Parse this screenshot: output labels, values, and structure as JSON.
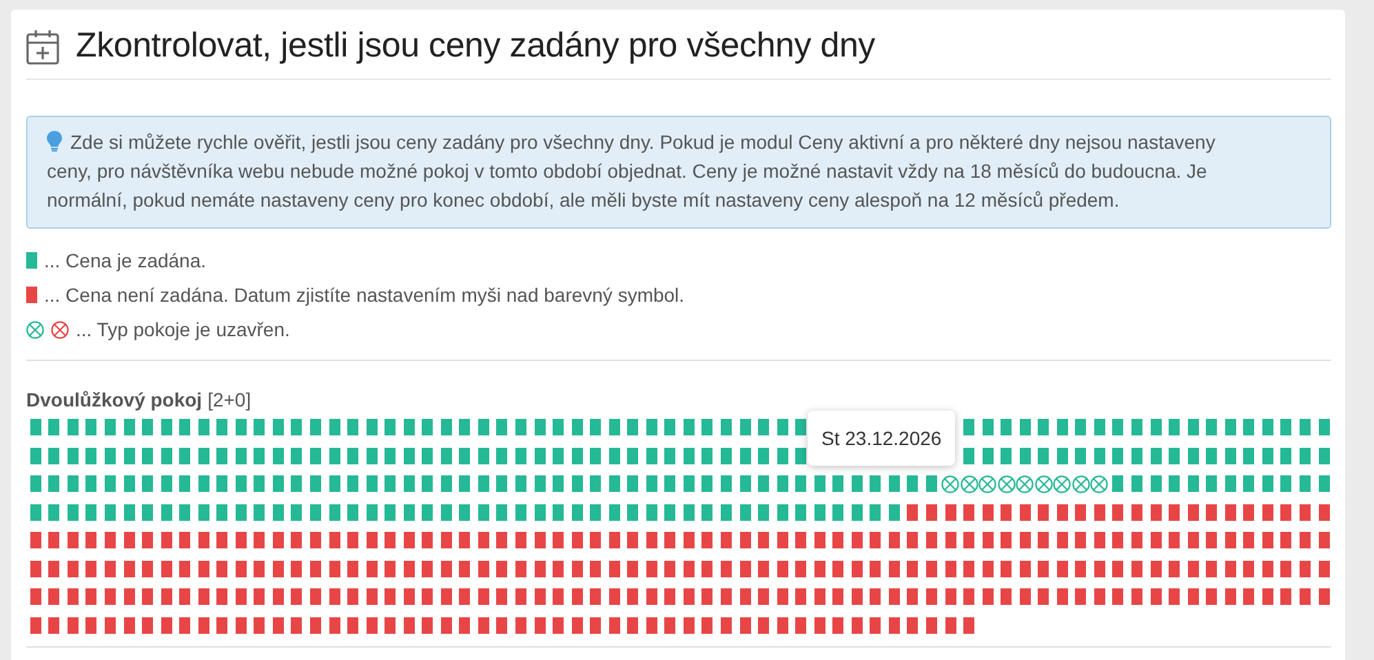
{
  "title": "Zkontrolovat, jestli jsou ceny zadány pro všechny dny",
  "info": "Zde si můžete rychle ověřit, jestli jsou ceny zadány pro všechny dny. Pokud je modul Ceny aktivní a pro některé dny nejsou nastaveny ceny, pro návštěvníka webu nebude možné pokoj v tomto období objednat. Ceny je možné nastavit vždy na 18 měsíců do budoucna. Je normální, pokud nemáte nastaveny ceny pro konec období, ale měli byste mít nastaveny ceny alespoň na 12 měsíců předem.",
  "legend": [
    {
      "kind": "set",
      "text": "... Cena je zadána."
    },
    {
      "kind": "unset",
      "text": "... Cena není zadána. Datum zjistíte nastavením myši nad barevný symbol."
    },
    {
      "kind": "closed",
      "text": "... Typ pokoje je uzavřen."
    }
  ],
  "rooms": [
    {
      "name": "Dvoulůžkový pokoj",
      "capacity": "[2+0]",
      "tooltip": "St 23.12.2026",
      "rows": [
        [
          {
            "kind": "set"
          },
          {
            "kind": "set"
          },
          {
            "kind": "set"
          },
          {
            "kind": "set"
          },
          {
            "kind": "set"
          },
          {
            "kind": "set"
          },
          {
            "kind": "set"
          },
          {
            "kind": "set"
          },
          {
            "kind": "set"
          },
          {
            "kind": "set"
          },
          {
            "kind": "set"
          },
          {
            "kind": "set"
          },
          {
            "kind": "set"
          },
          {
            "kind": "set"
          },
          {
            "kind": "set"
          },
          {
            "kind": "set"
          },
          {
            "kind": "set"
          },
          {
            "kind": "set"
          },
          {
            "kind": "set"
          },
          {
            "kind": "set"
          },
          {
            "kind": "set"
          },
          {
            "kind": "set"
          },
          {
            "kind": "set"
          },
          {
            "kind": "set"
          },
          {
            "kind": "set"
          },
          {
            "kind": "set"
          },
          {
            "kind": "set"
          },
          {
            "kind": "set"
          },
          {
            "kind": "set"
          },
          {
            "kind": "set"
          },
          {
            "kind": "set"
          },
          {
            "kind": "set"
          },
          {
            "kind": "set"
          },
          {
            "kind": "set"
          },
          {
            "kind": "set"
          },
          {
            "kind": "set"
          },
          {
            "kind": "set"
          },
          {
            "kind": "set"
          },
          {
            "kind": "set"
          },
          {
            "kind": "set"
          },
          {
            "kind": "set"
          },
          {
            "kind": "set"
          },
          null,
          null,
          null,
          null,
          null,
          null,
          null,
          null,
          {
            "kind": "set"
          },
          {
            "kind": "set"
          },
          {
            "kind": "set"
          },
          {
            "kind": "set"
          },
          {
            "kind": "set"
          },
          {
            "kind": "set"
          },
          {
            "kind": "set"
          },
          {
            "kind": "set"
          },
          {
            "kind": "set"
          },
          {
            "kind": "set"
          },
          {
            "kind": "set"
          },
          {
            "kind": "set"
          },
          {
            "kind": "set"
          },
          {
            "kind": "set"
          },
          {
            "kind": "set"
          },
          {
            "kind": "set"
          },
          {
            "kind": "set"
          },
          {
            "kind": "set"
          },
          {
            "kind": "set"
          },
          {
            "kind": "set"
          }
        ],
        [
          {
            "kind": "set"
          },
          {
            "kind": "set"
          },
          {
            "kind": "set"
          },
          {
            "kind": "set"
          },
          {
            "kind": "set"
          },
          {
            "kind": "set"
          },
          {
            "kind": "set"
          },
          {
            "kind": "set"
          },
          {
            "kind": "set"
          },
          {
            "kind": "set"
          },
          {
            "kind": "set"
          },
          {
            "kind": "set"
          },
          {
            "kind": "set"
          },
          {
            "kind": "set"
          },
          {
            "kind": "set"
          },
          {
            "kind": "set"
          },
          {
            "kind": "set"
          },
          {
            "kind": "set"
          },
          {
            "kind": "set"
          },
          {
            "kind": "set"
          },
          {
            "kind": "set"
          },
          {
            "kind": "set"
          },
          {
            "kind": "set"
          },
          {
            "kind": "set"
          },
          {
            "kind": "set"
          },
          {
            "kind": "set"
          },
          {
            "kind": "set"
          },
          {
            "kind": "set"
          },
          {
            "kind": "set"
          },
          {
            "kind": "set"
          },
          {
            "kind": "set"
          },
          {
            "kind": "set"
          },
          {
            "kind": "set"
          },
          {
            "kind": "set"
          },
          {
            "kind": "set"
          },
          {
            "kind": "set"
          },
          {
            "kind": "set"
          },
          {
            "kind": "set"
          },
          {
            "kind": "set"
          },
          {
            "kind": "set"
          },
          {
            "kind": "set"
          },
          {
            "kind": "set"
          },
          null,
          null,
          null,
          null,
          null,
          null,
          null,
          null,
          {
            "kind": "set"
          },
          {
            "kind": "set"
          },
          {
            "kind": "set"
          },
          {
            "kind": "set"
          },
          {
            "kind": "set"
          },
          {
            "kind": "set"
          },
          {
            "kind": "set"
          },
          {
            "kind": "set"
          },
          {
            "kind": "set"
          },
          {
            "kind": "set"
          },
          {
            "kind": "set"
          },
          {
            "kind": "set"
          },
          {
            "kind": "set"
          },
          {
            "kind": "set"
          },
          {
            "kind": "set"
          },
          {
            "kind": "set"
          },
          {
            "kind": "set"
          },
          {
            "kind": "set"
          },
          {
            "kind": "set"
          },
          {
            "kind": "set"
          }
        ],
        [
          {
            "kind": "set"
          },
          {
            "kind": "set"
          },
          {
            "kind": "set"
          },
          {
            "kind": "set"
          },
          {
            "kind": "set"
          },
          {
            "kind": "set"
          },
          {
            "kind": "set"
          },
          {
            "kind": "set"
          },
          {
            "kind": "set"
          },
          {
            "kind": "set"
          },
          {
            "kind": "set"
          },
          {
            "kind": "set"
          },
          {
            "kind": "set"
          },
          {
            "kind": "set"
          },
          {
            "kind": "set"
          },
          {
            "kind": "set"
          },
          {
            "kind": "set"
          },
          {
            "kind": "set"
          },
          {
            "kind": "set"
          },
          {
            "kind": "set"
          },
          {
            "kind": "set"
          },
          {
            "kind": "set"
          },
          {
            "kind": "set"
          },
          {
            "kind": "set"
          },
          {
            "kind": "set"
          },
          {
            "kind": "set"
          },
          {
            "kind": "set"
          },
          {
            "kind": "set"
          },
          {
            "kind": "set"
          },
          {
            "kind": "set"
          },
          {
            "kind": "set"
          },
          {
            "kind": "set"
          },
          {
            "kind": "set"
          },
          {
            "kind": "set"
          },
          {
            "kind": "set"
          },
          {
            "kind": "set"
          },
          {
            "kind": "set"
          },
          {
            "kind": "set"
          },
          {
            "kind": "set"
          },
          {
            "kind": "set"
          },
          {
            "kind": "set"
          },
          {
            "kind": "set"
          },
          {
            "kind": "set"
          },
          {
            "kind": "set"
          },
          {
            "kind": "set"
          },
          {
            "kind": "set"
          },
          {
            "kind": "set"
          },
          {
            "kind": "set"
          },
          {
            "kind": "set"
          },
          {
            "kind": "closed"
          },
          {
            "kind": "closed"
          },
          {
            "kind": "closed"
          },
          {
            "kind": "closed"
          },
          {
            "kind": "closed"
          },
          {
            "kind": "closed"
          },
          {
            "kind": "closed"
          },
          {
            "kind": "closed"
          },
          {
            "kind": "closed"
          },
          {
            "kind": "set"
          },
          {
            "kind": "set"
          },
          {
            "kind": "set"
          },
          {
            "kind": "set"
          },
          {
            "kind": "set"
          },
          {
            "kind": "set"
          },
          {
            "kind": "set"
          },
          {
            "kind": "set"
          },
          {
            "kind": "set"
          },
          {
            "kind": "set"
          },
          {
            "kind": "set"
          },
          {
            "kind": "set"
          }
        ],
        [
          {
            "kind": "set"
          },
          {
            "kind": "set"
          },
          {
            "kind": "set"
          },
          {
            "kind": "set"
          },
          {
            "kind": "set"
          },
          {
            "kind": "set"
          },
          {
            "kind": "set"
          },
          {
            "kind": "set"
          },
          {
            "kind": "set"
          },
          {
            "kind": "set"
          },
          {
            "kind": "set"
          },
          {
            "kind": "set"
          },
          {
            "kind": "set"
          },
          {
            "kind": "set"
          },
          {
            "kind": "set"
          },
          {
            "kind": "set"
          },
          {
            "kind": "set"
          },
          {
            "kind": "set"
          },
          {
            "kind": "set"
          },
          {
            "kind": "set"
          },
          {
            "kind": "set"
          },
          {
            "kind": "set"
          },
          {
            "kind": "set"
          },
          {
            "kind": "set"
          },
          {
            "kind": "set"
          },
          {
            "kind": "set"
          },
          {
            "kind": "set"
          },
          {
            "kind": "set"
          },
          {
            "kind": "set"
          },
          {
            "kind": "set"
          },
          {
            "kind": "set"
          },
          {
            "kind": "set"
          },
          {
            "kind": "set"
          },
          {
            "kind": "set"
          },
          {
            "kind": "set"
          },
          {
            "kind": "set"
          },
          {
            "kind": "set"
          },
          {
            "kind": "set"
          },
          {
            "kind": "set"
          },
          {
            "kind": "set"
          },
          {
            "kind": "set"
          },
          {
            "kind": "set"
          },
          {
            "kind": "set"
          },
          {
            "kind": "set"
          },
          {
            "kind": "set"
          },
          {
            "kind": "set"
          },
          {
            "kind": "set"
          },
          {
            "kind": "unset"
          },
          {
            "kind": "unset"
          },
          {
            "kind": "unset"
          },
          {
            "kind": "unset"
          },
          {
            "kind": "unset"
          },
          {
            "kind": "unset"
          },
          {
            "kind": "unset"
          },
          {
            "kind": "unset"
          },
          {
            "kind": "unset"
          },
          {
            "kind": "unset"
          },
          {
            "kind": "unset"
          },
          {
            "kind": "unset"
          },
          {
            "kind": "unset"
          },
          {
            "kind": "unset"
          },
          {
            "kind": "unset"
          },
          {
            "kind": "unset"
          },
          {
            "kind": "unset"
          },
          {
            "kind": "unset"
          },
          {
            "kind": "unset"
          },
          {
            "kind": "unset"
          },
          {
            "kind": "unset"
          },
          {
            "kind": "unset"
          },
          {
            "kind": "unset"
          }
        ],
        [
          {
            "kind": "unset"
          },
          {
            "kind": "unset"
          },
          {
            "kind": "unset"
          },
          {
            "kind": "unset"
          },
          {
            "kind": "unset"
          },
          {
            "kind": "unset"
          },
          {
            "kind": "unset"
          },
          {
            "kind": "unset"
          },
          {
            "kind": "unset"
          },
          {
            "kind": "unset"
          },
          {
            "kind": "unset"
          },
          {
            "kind": "unset"
          },
          {
            "kind": "unset"
          },
          {
            "kind": "unset"
          },
          {
            "kind": "unset"
          },
          {
            "kind": "unset"
          },
          {
            "kind": "unset"
          },
          {
            "kind": "unset"
          },
          {
            "kind": "unset"
          },
          {
            "kind": "unset"
          },
          {
            "kind": "unset"
          },
          {
            "kind": "unset"
          },
          {
            "kind": "unset"
          },
          {
            "kind": "unset"
          },
          {
            "kind": "unset"
          },
          {
            "kind": "unset"
          },
          {
            "kind": "unset"
          },
          {
            "kind": "unset"
          },
          {
            "kind": "unset"
          },
          {
            "kind": "unset"
          },
          {
            "kind": "unset"
          },
          {
            "kind": "unset"
          },
          {
            "kind": "unset"
          },
          {
            "kind": "unset"
          },
          {
            "kind": "unset"
          },
          {
            "kind": "unset"
          },
          {
            "kind": "unset"
          },
          {
            "kind": "unset"
          },
          {
            "kind": "unset"
          },
          {
            "kind": "unset"
          },
          {
            "kind": "unset"
          },
          {
            "kind": "unset"
          },
          {
            "kind": "unset"
          },
          {
            "kind": "unset"
          },
          {
            "kind": "unset"
          },
          {
            "kind": "unset"
          },
          {
            "kind": "unset"
          },
          {
            "kind": "unset"
          },
          {
            "kind": "unset"
          },
          {
            "kind": "unset"
          },
          {
            "kind": "unset"
          },
          {
            "kind": "unset"
          },
          {
            "kind": "unset"
          },
          {
            "kind": "unset"
          },
          {
            "kind": "unset"
          },
          {
            "kind": "unset"
          },
          {
            "kind": "unset"
          },
          {
            "kind": "unset"
          },
          {
            "kind": "unset"
          },
          {
            "kind": "unset"
          },
          {
            "kind": "unset"
          },
          {
            "kind": "unset"
          },
          {
            "kind": "unset"
          },
          {
            "kind": "unset"
          },
          {
            "kind": "unset"
          },
          {
            "kind": "unset"
          },
          {
            "kind": "unset"
          },
          {
            "kind": "unset"
          },
          {
            "kind": "unset"
          },
          {
            "kind": "unset"
          }
        ],
        [
          {
            "kind": "unset"
          },
          {
            "kind": "unset"
          },
          {
            "kind": "unset"
          },
          {
            "kind": "unset"
          },
          {
            "kind": "unset"
          },
          {
            "kind": "unset"
          },
          {
            "kind": "unset"
          },
          {
            "kind": "unset"
          },
          {
            "kind": "unset"
          },
          {
            "kind": "unset"
          },
          {
            "kind": "unset"
          },
          {
            "kind": "unset"
          },
          {
            "kind": "unset"
          },
          {
            "kind": "unset"
          },
          {
            "kind": "unset"
          },
          {
            "kind": "unset"
          },
          {
            "kind": "unset"
          },
          {
            "kind": "unset"
          },
          {
            "kind": "unset"
          },
          {
            "kind": "unset"
          },
          {
            "kind": "unset"
          },
          {
            "kind": "unset"
          },
          {
            "kind": "unset"
          },
          {
            "kind": "unset"
          },
          {
            "kind": "unset"
          },
          {
            "kind": "unset"
          },
          {
            "kind": "unset"
          },
          {
            "kind": "unset"
          },
          {
            "kind": "unset"
          },
          {
            "kind": "unset"
          },
          {
            "kind": "unset"
          },
          {
            "kind": "unset"
          },
          {
            "kind": "unset"
          },
          {
            "kind": "unset"
          },
          {
            "kind": "unset"
          },
          {
            "kind": "unset"
          },
          {
            "kind": "unset"
          },
          {
            "kind": "unset"
          },
          {
            "kind": "unset"
          },
          {
            "kind": "unset"
          },
          {
            "kind": "unset"
          },
          {
            "kind": "unset"
          },
          {
            "kind": "unset"
          },
          {
            "kind": "unset"
          },
          {
            "kind": "unset"
          },
          {
            "kind": "unset"
          },
          {
            "kind": "unset"
          },
          {
            "kind": "unset"
          },
          {
            "kind": "unset"
          },
          {
            "kind": "unset"
          },
          {
            "kind": "unset"
          },
          {
            "kind": "unset"
          },
          {
            "kind": "unset"
          },
          {
            "kind": "unset"
          },
          {
            "kind": "unset"
          },
          {
            "kind": "unset"
          },
          {
            "kind": "unset"
          },
          {
            "kind": "unset"
          },
          {
            "kind": "unset"
          },
          {
            "kind": "unset"
          },
          {
            "kind": "unset"
          },
          {
            "kind": "unset"
          },
          {
            "kind": "unset"
          },
          {
            "kind": "unset"
          },
          {
            "kind": "unset"
          },
          {
            "kind": "unset"
          },
          {
            "kind": "unset"
          },
          {
            "kind": "unset"
          },
          {
            "kind": "unset"
          },
          {
            "kind": "unset"
          }
        ],
        [
          {
            "kind": "unset"
          },
          {
            "kind": "unset"
          },
          {
            "kind": "unset"
          },
          {
            "kind": "unset"
          },
          {
            "kind": "unset"
          },
          {
            "kind": "unset"
          },
          {
            "kind": "unset"
          },
          {
            "kind": "unset"
          },
          {
            "kind": "unset"
          },
          {
            "kind": "unset"
          },
          {
            "kind": "unset"
          },
          {
            "kind": "unset"
          },
          {
            "kind": "unset"
          },
          {
            "kind": "unset"
          },
          {
            "kind": "unset"
          },
          {
            "kind": "unset"
          },
          {
            "kind": "unset"
          },
          {
            "kind": "unset"
          },
          {
            "kind": "unset"
          },
          {
            "kind": "unset"
          },
          {
            "kind": "unset"
          },
          {
            "kind": "unset"
          },
          {
            "kind": "unset"
          },
          {
            "kind": "unset"
          },
          {
            "kind": "unset"
          },
          {
            "kind": "unset"
          },
          {
            "kind": "unset"
          },
          {
            "kind": "unset"
          },
          {
            "kind": "unset"
          },
          {
            "kind": "unset"
          },
          {
            "kind": "unset"
          },
          {
            "kind": "unset"
          },
          {
            "kind": "unset"
          },
          {
            "kind": "unset"
          },
          {
            "kind": "unset"
          },
          {
            "kind": "unset"
          },
          {
            "kind": "unset"
          },
          {
            "kind": "unset"
          },
          {
            "kind": "unset"
          },
          {
            "kind": "unset"
          },
          {
            "kind": "unset"
          },
          {
            "kind": "unset"
          },
          {
            "kind": "unset"
          },
          {
            "kind": "unset"
          },
          {
            "kind": "unset"
          },
          {
            "kind": "unset"
          },
          {
            "kind": "unset"
          },
          {
            "kind": "unset"
          },
          {
            "kind": "unset"
          },
          {
            "kind": "unset"
          },
          {
            "kind": "unset"
          },
          {
            "kind": "unset"
          },
          {
            "kind": "unset"
          },
          {
            "kind": "unset"
          },
          {
            "kind": "unset"
          },
          {
            "kind": "unset"
          },
          {
            "kind": "unset"
          },
          {
            "kind": "unset"
          },
          {
            "kind": "unset"
          },
          {
            "kind": "unset"
          },
          {
            "kind": "unset"
          },
          {
            "kind": "unset"
          },
          {
            "kind": "unset"
          },
          {
            "kind": "unset"
          },
          {
            "kind": "unset"
          },
          {
            "kind": "unset"
          },
          {
            "kind": "unset"
          },
          {
            "kind": "unset"
          },
          {
            "kind": "unset"
          },
          {
            "kind": "unset"
          }
        ],
        [
          {
            "kind": "unset"
          },
          {
            "kind": "unset"
          },
          {
            "kind": "unset"
          },
          {
            "kind": "unset"
          },
          {
            "kind": "unset"
          },
          {
            "kind": "unset"
          },
          {
            "kind": "unset"
          },
          {
            "kind": "unset"
          },
          {
            "kind": "unset"
          },
          {
            "kind": "unset"
          },
          {
            "kind": "unset"
          },
          {
            "kind": "unset"
          },
          {
            "kind": "unset"
          },
          {
            "kind": "unset"
          },
          {
            "kind": "unset"
          },
          {
            "kind": "unset"
          },
          {
            "kind": "unset"
          },
          {
            "kind": "unset"
          },
          {
            "kind": "unset"
          },
          {
            "kind": "unset"
          },
          {
            "kind": "unset"
          },
          {
            "kind": "unset"
          },
          {
            "kind": "unset"
          },
          {
            "kind": "unset"
          },
          {
            "kind": "unset"
          },
          {
            "kind": "unset"
          },
          {
            "kind": "unset"
          },
          {
            "kind": "unset"
          },
          {
            "kind": "unset"
          },
          {
            "kind": "unset"
          },
          {
            "kind": "unset"
          },
          {
            "kind": "unset"
          },
          {
            "kind": "unset"
          },
          {
            "kind": "unset"
          },
          {
            "kind": "unset"
          },
          {
            "kind": "unset"
          },
          {
            "kind": "unset"
          },
          {
            "kind": "unset"
          },
          {
            "kind": "unset"
          },
          {
            "kind": "unset"
          },
          {
            "kind": "unset"
          },
          {
            "kind": "unset"
          },
          {
            "kind": "unset"
          },
          {
            "kind": "unset"
          },
          {
            "kind": "unset"
          },
          {
            "kind": "unset"
          },
          {
            "kind": "unset"
          },
          {
            "kind": "unset"
          },
          {
            "kind": "unset"
          },
          {
            "kind": "unset"
          },
          {
            "kind": "unset"
          }
        ]
      ]
    }
  ]
}
